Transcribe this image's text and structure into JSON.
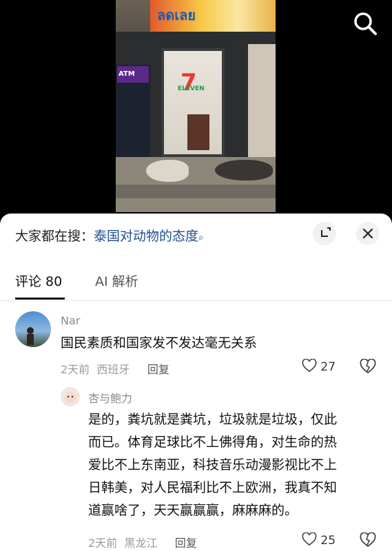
{
  "video": {
    "banner_text": "ลดเลย",
    "atm_label": "ATM",
    "logo_number": "7",
    "logo_word": "ELEVEN",
    "search_icon": "search-icon"
  },
  "panel": {
    "suggest_prefix": "大家都在搜：",
    "suggest_term": "泰国对动物的态度",
    "suggest_icon": "search-icon",
    "collapse_icon": "collapse-icon",
    "close_icon": "close-icon"
  },
  "tabs": [
    {
      "label": "评论 80",
      "active": true
    },
    {
      "label": "AI 解析",
      "active": false
    }
  ],
  "comments": [
    {
      "user": "Nar",
      "text": "国民素质和国家发不发达毫无关系",
      "time": "2天前",
      "location": "西班牙",
      "reply_label": "回复",
      "likes": "27"
    }
  ],
  "replies": [
    {
      "user": "杏与鲍力",
      "lines": [
        "是的，粪坑就是粪坑，垃圾就是垃圾，仅此",
        "而已。体育足球比不上佛得角，对生命的热",
        "爱比不上东南亚，科技音乐动漫影视比不上",
        "日韩美，对人民福利比不上欧洲，我真不知",
        "道赢啥了，天天赢赢赢，麻麻麻的。"
      ],
      "time": "2天前",
      "location": "黑龙江",
      "reply_label": "回复",
      "likes": "25"
    }
  ],
  "colors": {
    "link": "#1e4f8f",
    "meta": "#9a9a9a",
    "background": "#ffffff"
  }
}
